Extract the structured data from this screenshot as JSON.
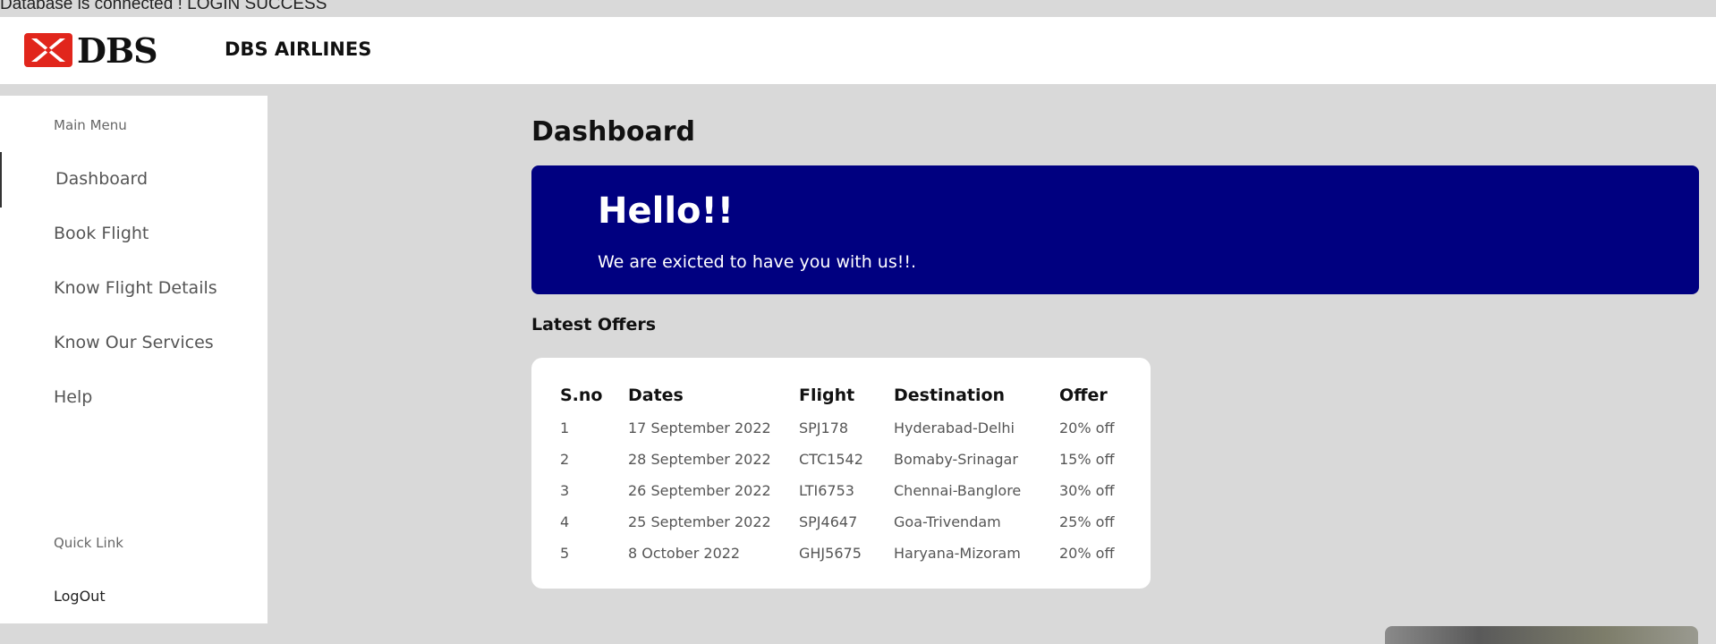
{
  "status_text": "Database is connected ! LOGIN SUCCESS",
  "brand": {
    "logo_text": "DBS",
    "logo_icon": "dbs-x-logo-icon",
    "app_name": "DBS AIRLINES",
    "logo_color": "#e1261c"
  },
  "sidebar": {
    "main_menu_label": "Main Menu",
    "items": [
      {
        "label": "Dashboard",
        "active": true
      },
      {
        "label": "Book Flight"
      },
      {
        "label": "Know Flight Details"
      },
      {
        "label": "Know Our Services"
      },
      {
        "label": "Help"
      }
    ],
    "quick_link_label": "Quick Link",
    "logout_label": "LogOut"
  },
  "main": {
    "title": "Dashboard",
    "hero": {
      "title": "Hello!!",
      "subtitle": "We are exicted to have you with us!!.",
      "background": "#000080"
    },
    "offers": {
      "title": "Latest Offers",
      "columns": [
        "S.no",
        "Dates",
        "Flight",
        "Destination",
        "Offer"
      ],
      "rows": [
        [
          "1",
          "17 September 2022",
          "SPJ178",
          "Hyderabad-Delhi",
          "20% off"
        ],
        [
          "2",
          "28 September 2022",
          "CTC1542",
          "Bomaby-Srinagar",
          "15% off"
        ],
        [
          "3",
          "26 September 2022",
          "LTI6753",
          "Chennai-Banglore",
          "30% off"
        ],
        [
          "4",
          "25 September 2022",
          "SPJ4647",
          "Goa-Trivendam",
          "25% off"
        ],
        [
          "5",
          "8 October 2022",
          "GHJ5675",
          "Haryana-Mizoram",
          "20% off"
        ]
      ]
    }
  }
}
